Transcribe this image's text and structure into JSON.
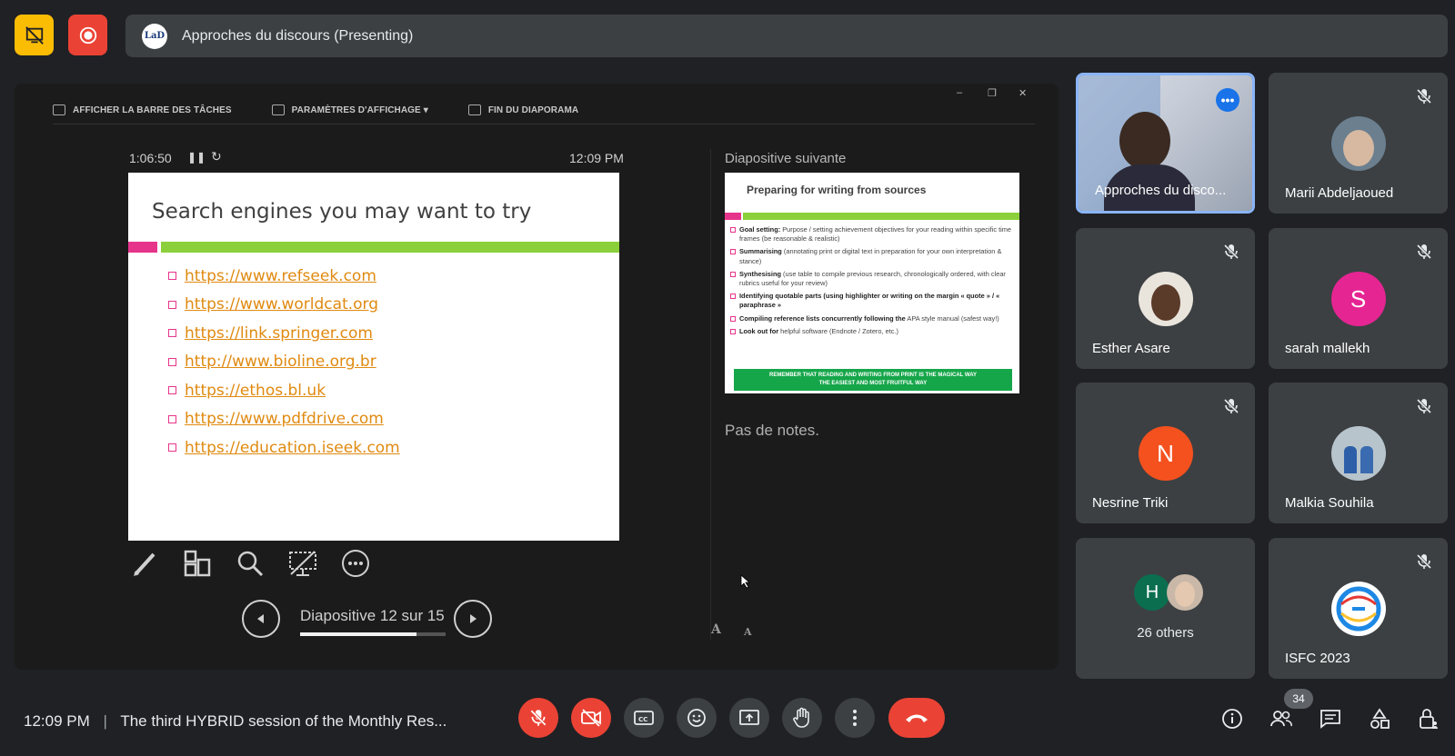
{
  "banner": {
    "avatar_text": "LaD",
    "title": "Approches du discours (Presenting)"
  },
  "powerpoint": {
    "toolbar": [
      "AFFICHER LA BARRE DES TÂCHES",
      "PARAMÈTRES D'AFFICHAGE ▾",
      "FIN DU DIAPORAMA"
    ],
    "window_controls": [
      "–",
      "❐",
      "✕"
    ],
    "elapsed": "1:06:50",
    "clock": "12:09 PM",
    "next_slide_label": "Diapositive suivante",
    "notes": "Pas de notes.",
    "slide_counter": "Diapositive 12 sur 15",
    "slide_progress": 0.8,
    "font_up": "A",
    "font_down": "A"
  },
  "current_slide": {
    "title": "Search engines you may want to try",
    "links": [
      "https://www.refseek.com",
      "https://www.worldcat.org",
      "https://link.springer.com",
      "http://www.bioline.org.br",
      "https://ethos.bl.uk",
      "https://www.pdfdrive.com",
      "https://education.iseek.com"
    ]
  },
  "next_slide": {
    "title": "Preparing for writing from sources",
    "items": [
      {
        "bold": "Goal setting:",
        "text": " Purpose / setting achievement objectives for your reading within specific time frames (be reasonable & realistic)"
      },
      {
        "bold": "Summarising",
        "text": " (annotating print or digital text in preparation for your own interpretation & stance)"
      },
      {
        "bold": "Synthesising",
        "text": " (use table to compile previous research, chronologically ordered, with clear rubrics useful for your review)"
      },
      {
        "bold": "Identifying quotable parts (using highlighter or writing on the margin « quote » / « paraphrase »",
        "text": ""
      },
      {
        "bold": "Compiling reference lists concurrently following the",
        "text": " APA style manual (safest way!)"
      },
      {
        "bold": "Look out for",
        "text": " helpful software (Endnote / Zotero, etc.)"
      }
    ],
    "banner_line1": "REMEMBER THAT READING AND WRITING FROM PRINT IS THE MAGICAL WAY",
    "banner_line2": "THE EASIEST AND MOST FRUITFUL WAY"
  },
  "participants": [
    {
      "name": "Approches du disco...",
      "type": "video",
      "active": true
    },
    {
      "name": "Marii Abdeljaoued",
      "type": "photo",
      "muted": true
    },
    {
      "name": "Esther Asare",
      "type": "photo",
      "muted": true
    },
    {
      "name": "sarah mallekh",
      "type": "initial",
      "initial": "S",
      "color": "#e52592",
      "muted": true
    },
    {
      "name": "Nesrine Triki",
      "type": "initial",
      "initial": "N",
      "color": "#f4511e",
      "muted": true
    },
    {
      "name": "Malkia Souhila",
      "type": "photo",
      "muted": true
    },
    {
      "name": "26 others",
      "type": "group",
      "initial": "H",
      "color": "#0b6e4f"
    },
    {
      "name": "ISFC 2023",
      "type": "logo",
      "muted": true
    }
  ],
  "bottom": {
    "time": "12:09 PM",
    "separator": "|",
    "meeting_title": "The third HYBRID session of the Monthly Res...",
    "participant_count": "34"
  },
  "colors": {
    "background": "#202124",
    "tile": "#3c4043",
    "red": "#ea4335",
    "yellow": "#fbbc04",
    "accent_blue": "#8ab4f8",
    "slide_pink": "#e6348b",
    "slide_green": "#8bd03a",
    "link_orange": "#e08a10"
  }
}
